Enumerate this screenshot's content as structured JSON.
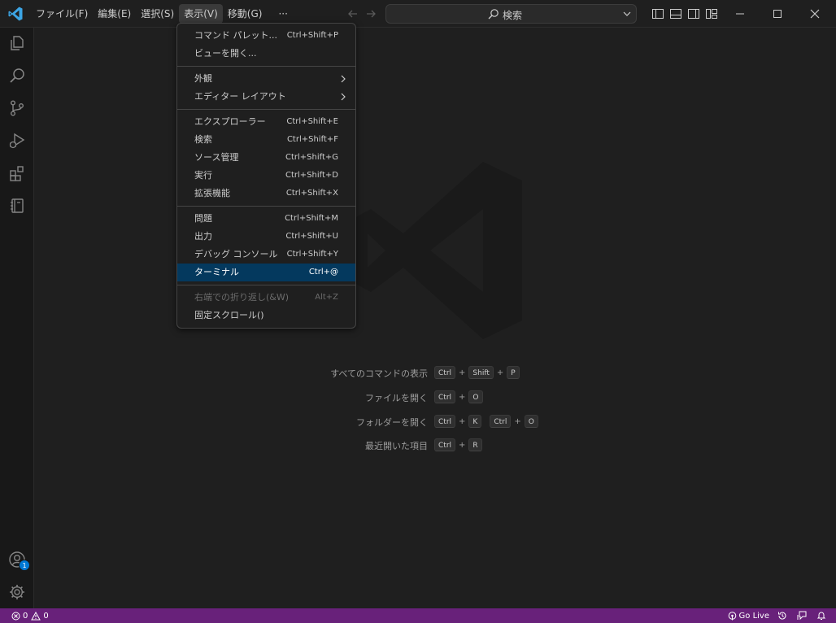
{
  "menubar": {
    "items": [
      "ファイル(F)",
      "編集(E)",
      "選択(S)",
      "表示(V)",
      "移動(G)"
    ],
    "more": "···"
  },
  "search": {
    "text": "検索"
  },
  "view_menu": {
    "groups": [
      [
        {
          "label": "コマンド パレット...",
          "shortcut": "Ctrl+Shift+P"
        },
        {
          "label": "ビューを開く...",
          "shortcut": ""
        }
      ],
      [
        {
          "label": "外観",
          "shortcut": "",
          "submenu": true
        },
        {
          "label": "エディター レイアウト",
          "shortcut": "",
          "submenu": true
        }
      ],
      [
        {
          "label": "エクスプローラー",
          "shortcut": "Ctrl+Shift+E"
        },
        {
          "label": "検索",
          "shortcut": "Ctrl+Shift+F"
        },
        {
          "label": "ソース管理",
          "shortcut": "Ctrl+Shift+G"
        },
        {
          "label": "実行",
          "shortcut": "Ctrl+Shift+D"
        },
        {
          "label": "拡張機能",
          "shortcut": "Ctrl+Shift+X"
        }
      ],
      [
        {
          "label": "問題",
          "shortcut": "Ctrl+Shift+M"
        },
        {
          "label": "出力",
          "shortcut": "Ctrl+Shift+U"
        },
        {
          "label": "デバッグ コンソール",
          "shortcut": "Ctrl+Shift+Y"
        },
        {
          "label": "ターミナル",
          "shortcut": "Ctrl+@",
          "selected": true
        }
      ],
      [
        {
          "label": "右端での折り返し(&W)",
          "shortcut": "Alt+Z",
          "disabled": true
        },
        {
          "label": "固定スクロール()",
          "shortcut": ""
        }
      ]
    ]
  },
  "shortcuts": [
    {
      "label": "すべてのコマンドの表示",
      "keys": [
        "Ctrl",
        "Shift",
        "P"
      ]
    },
    {
      "label": "ファイルを開く",
      "keys": [
        "Ctrl",
        "O"
      ]
    },
    {
      "label": "フォルダーを開く",
      "keys": [
        "Ctrl",
        "K"
      ],
      "keys2": [
        "Ctrl",
        "O"
      ]
    },
    {
      "label": "最近開いた項目",
      "keys": [
        "Ctrl",
        "R"
      ]
    }
  ],
  "accounts_badge": "1",
  "statusbar": {
    "errors": "0",
    "warnings": "0",
    "golive": "Go Live"
  },
  "colors": {
    "statusbar": "#68217a",
    "selection": "#04395e",
    "badge": "#0078d4",
    "logo": "#3ca5e5"
  }
}
